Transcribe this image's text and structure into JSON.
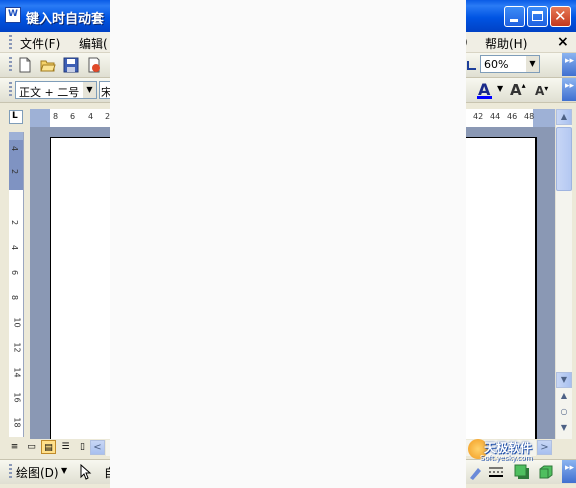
{
  "window": {
    "title": "键入时自动套",
    "app_icon_letter": "W"
  },
  "menubar": {
    "left_items": [
      "文件(F)",
      "编辑("
    ],
    "right_items": [
      ")",
      "帮助(H)"
    ],
    "close_glyph": "×"
  },
  "standard_toolbar": {
    "zoom_value": "60%",
    "icons": [
      "new-document-icon",
      "open-folder-icon",
      "save-icon",
      "permission-icon",
      "undo-icon"
    ]
  },
  "format_toolbar": {
    "style_value": "正文 + 二号",
    "font_value": "宋",
    "font_color_glyph": "A",
    "grow_font_glyph": "A",
    "shrink_font_glyph": "A"
  },
  "ruler": {
    "tab_selector_glyph": "L",
    "left_numbers": [
      "8",
      "6",
      "4",
      "2"
    ],
    "right_numbers": [
      "42",
      "44",
      "46",
      "48"
    ],
    "vertical_numbers": [
      "4",
      "2",
      "2",
      "4",
      "6",
      "8",
      "10",
      "12",
      "14",
      "16",
      "18"
    ]
  },
  "scrollbar": {
    "up_arrow": "▲",
    "down_arrow": "▼",
    "prev_page": "▲",
    "select_browse": "○",
    "next_page": "▼"
  },
  "view_buttons": [
    "≡",
    "▭",
    "▤",
    "☰",
    "▯"
  ],
  "hscroll": {
    "left_arrow": "<",
    "right_arrow": ">"
  },
  "drawing_toolbar": {
    "draw_menu": "绘图(D)",
    "autoshapes_partial": "自",
    "watermark_text": "天极软件",
    "watermark_url": "Soft.yesky.com"
  },
  "colors": {
    "titlebar_blue": "#0054e3",
    "toolbar_bg": "#ece9d8",
    "doc_background": "#8a98b4",
    "font_color_underline": "#0000ff"
  }
}
